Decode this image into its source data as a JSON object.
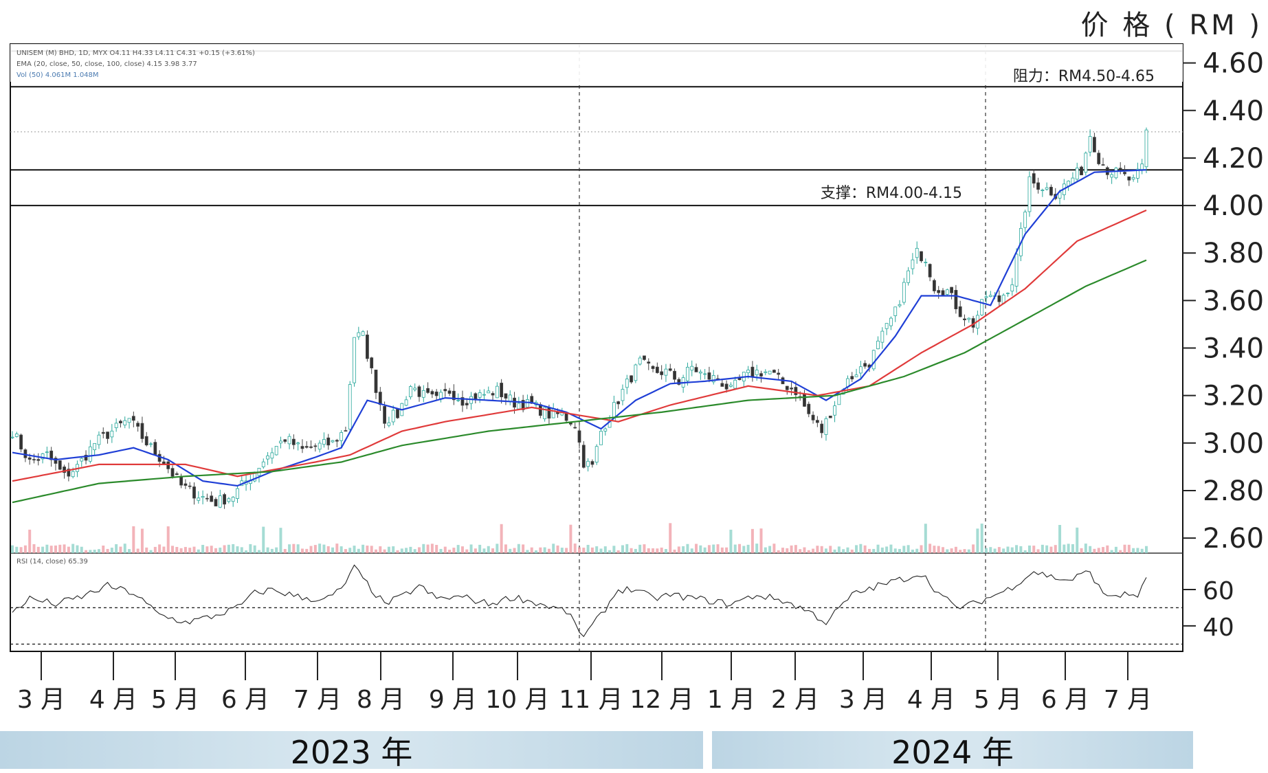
{
  "price_axis_title": "价 格 ( RM )",
  "header": {
    "line1": "UNISEM (M) BHD, 1D, MYX O4.11 H4.33 L4.11 C4.31 +0.15 (+3.61%)",
    "line2": "EMA (20, close, 50, close, 100, close) 4.15 3.98 3.77",
    "line3": "Vol (50) 4.061M 1.048M"
  },
  "annotations": {
    "resistance": "阻力：RM4.50-4.65",
    "support": "支撑：RM4.00-4.15"
  },
  "rsi_label": "RSI (14, close) 65.39",
  "years": [
    "2023 年",
    "2024 年"
  ],
  "chart_data": {
    "type": "candlestick",
    "title": "",
    "price_axis": {
      "ticks": [
        "4.60",
        "4.40",
        "4.20",
        "4.00",
        "3.80",
        "3.60",
        "3.40",
        "3.20",
        "3.00",
        "2.80",
        "2.60"
      ],
      "ylim": [
        2.58,
        4.68
      ]
    },
    "rsi_axis": {
      "ticks": [
        "60",
        "40"
      ],
      "ylim": [
        26,
        80
      ],
      "reference_lines": [
        50,
        30
      ]
    },
    "months": [
      "3 月",
      "4 月",
      "5 月",
      "6 月",
      "7 月",
      "8 月",
      "9 月",
      "10 月",
      "11 月",
      "12 月",
      "1 月",
      "2 月",
      "3 月",
      "4 月",
      "5 月",
      "6 月",
      "7 月"
    ],
    "horizontal_levels": [
      4.65,
      4.5,
      4.15,
      4.0
    ],
    "dotted_level": 4.31,
    "price_anchors": [
      [
        0,
        3.05
      ],
      [
        4,
        2.92
      ],
      [
        8,
        2.95
      ],
      [
        12,
        2.86
      ],
      [
        15,
        2.9
      ],
      [
        19,
        3.0
      ],
      [
        23,
        3.05
      ],
      [
        27,
        3.1
      ],
      [
        31,
        3.0
      ],
      [
        35,
        2.92
      ],
      [
        39,
        2.82
      ],
      [
        43,
        2.78
      ],
      [
        47,
        2.75
      ],
      [
        51,
        2.78
      ],
      [
        55,
        2.86
      ],
      [
        59,
        2.95
      ],
      [
        63,
        3.02
      ],
      [
        67,
        2.97
      ],
      [
        71,
        2.99
      ],
      [
        74,
        3.0
      ],
      [
        77,
        3.06
      ],
      [
        79,
        3.45
      ],
      [
        81,
        3.45
      ],
      [
        83,
        3.3
      ],
      [
        86,
        3.1
      ],
      [
        89,
        3.12
      ],
      [
        92,
        3.24
      ],
      [
        95,
        3.2
      ],
      [
        98,
        3.18
      ],
      [
        101,
        3.22
      ],
      [
        104,
        3.18
      ],
      [
        108,
        3.2
      ],
      [
        112,
        3.22
      ],
      [
        116,
        3.17
      ],
      [
        120,
        3.16
      ],
      [
        124,
        3.12
      ],
      [
        127,
        3.12
      ],
      [
        130,
        3.08
      ],
      [
        132,
        2.92
      ],
      [
        134,
        2.9
      ],
      [
        136,
        3.05
      ],
      [
        139,
        3.15
      ],
      [
        142,
        3.25
      ],
      [
        145,
        3.34
      ],
      [
        148,
        3.3
      ],
      [
        151,
        3.3
      ],
      [
        154,
        3.26
      ],
      [
        157,
        3.32
      ],
      [
        160,
        3.28
      ],
      [
        163,
        3.27
      ],
      [
        166,
        3.22
      ],
      [
        169,
        3.28
      ],
      [
        172,
        3.3
      ],
      [
        175,
        3.3
      ],
      [
        178,
        3.25
      ],
      [
        181,
        3.22
      ],
      [
        184,
        3.12
      ],
      [
        187,
        3.05
      ],
      [
        189,
        3.13
      ],
      [
        192,
        3.24
      ],
      [
        195,
        3.3
      ],
      [
        198,
        3.34
      ],
      [
        201,
        3.45
      ],
      [
        204,
        3.55
      ],
      [
        207,
        3.72
      ],
      [
        209,
        3.8
      ],
      [
        211,
        3.78
      ],
      [
        213,
        3.66
      ],
      [
        216,
        3.64
      ],
      [
        219,
        3.55
      ],
      [
        222,
        3.5
      ],
      [
        225,
        3.62
      ],
      [
        228,
        3.6
      ],
      [
        231,
        3.68
      ],
      [
        233,
        3.88
      ],
      [
        235,
        4.1
      ],
      [
        238,
        4.08
      ],
      [
        241,
        4.05
      ],
      [
        244,
        4.1
      ],
      [
        247,
        4.15
      ],
      [
        249,
        4.3
      ],
      [
        251,
        4.2
      ],
      [
        253,
        4.15
      ],
      [
        256,
        4.13
      ],
      [
        259,
        4.1
      ],
      [
        261,
        4.16
      ],
      [
        262,
        4.31
      ]
    ],
    "ema_anchors": {
      "EMA20": [
        [
          0,
          2.96
        ],
        [
          10,
          2.93
        ],
        [
          20,
          2.95
        ],
        [
          28,
          2.98
        ],
        [
          36,
          2.93
        ],
        [
          44,
          2.84
        ],
        [
          52,
          2.82
        ],
        [
          60,
          2.88
        ],
        [
          70,
          2.94
        ],
        [
          76,
          2.98
        ],
        [
          82,
          3.18
        ],
        [
          90,
          3.14
        ],
        [
          100,
          3.19
        ],
        [
          110,
          3.18
        ],
        [
          120,
          3.17
        ],
        [
          128,
          3.13
        ],
        [
          136,
          3.06
        ],
        [
          144,
          3.18
        ],
        [
          152,
          3.25
        ],
        [
          160,
          3.26
        ],
        [
          170,
          3.28
        ],
        [
          180,
          3.26
        ],
        [
          188,
          3.18
        ],
        [
          196,
          3.27
        ],
        [
          204,
          3.45
        ],
        [
          210,
          3.62
        ],
        [
          218,
          3.62
        ],
        [
          226,
          3.58
        ],
        [
          234,
          3.88
        ],
        [
          242,
          4.06
        ],
        [
          250,
          4.14
        ],
        [
          262,
          4.15
        ]
      ],
      "EMA50": [
        [
          0,
          2.84
        ],
        [
          20,
          2.91
        ],
        [
          40,
          2.91
        ],
        [
          52,
          2.86
        ],
        [
          70,
          2.92
        ],
        [
          78,
          2.95
        ],
        [
          90,
          3.05
        ],
        [
          100,
          3.09
        ],
        [
          120,
          3.15
        ],
        [
          130,
          3.12
        ],
        [
          140,
          3.09
        ],
        [
          152,
          3.16
        ],
        [
          170,
          3.24
        ],
        [
          186,
          3.2
        ],
        [
          198,
          3.24
        ],
        [
          210,
          3.38
        ],
        [
          222,
          3.5
        ],
        [
          234,
          3.65
        ],
        [
          246,
          3.85
        ],
        [
          262,
          3.98
        ]
      ],
      "EMA100": [
        [
          0,
          2.75
        ],
        [
          20,
          2.83
        ],
        [
          40,
          2.86
        ],
        [
          60,
          2.88
        ],
        [
          76,
          2.92
        ],
        [
          90,
          2.99
        ],
        [
          110,
          3.05
        ],
        [
          130,
          3.09
        ],
        [
          150,
          3.13
        ],
        [
          170,
          3.18
        ],
        [
          190,
          3.2
        ],
        [
          206,
          3.28
        ],
        [
          220,
          3.38
        ],
        [
          234,
          3.52
        ],
        [
          248,
          3.66
        ],
        [
          262,
          3.77
        ]
      ]
    },
    "rsi_anchors": [
      [
        0,
        48
      ],
      [
        4,
        55
      ],
      [
        10,
        52
      ],
      [
        16,
        56
      ],
      [
        22,
        62
      ],
      [
        28,
        58
      ],
      [
        34,
        46
      ],
      [
        40,
        42
      ],
      [
        46,
        45
      ],
      [
        52,
        50
      ],
      [
        56,
        58
      ],
      [
        60,
        60
      ],
      [
        66,
        56
      ],
      [
        72,
        54
      ],
      [
        76,
        60
      ],
      [
        79,
        72
      ],
      [
        83,
        60
      ],
      [
        86,
        52
      ],
      [
        90,
        56
      ],
      [
        94,
        62
      ],
      [
        98,
        55
      ],
      [
        104,
        56
      ],
      [
        110,
        52
      ],
      [
        116,
        56
      ],
      [
        122,
        52
      ],
      [
        128,
        48
      ],
      [
        132,
        34
      ],
      [
        136,
        46
      ],
      [
        140,
        60
      ],
      [
        144,
        60
      ],
      [
        148,
        55
      ],
      [
        152,
        57
      ],
      [
        158,
        55
      ],
      [
        166,
        52
      ],
      [
        172,
        57
      ],
      [
        178,
        54
      ],
      [
        184,
        48
      ],
      [
        188,
        42
      ],
      [
        194,
        57
      ],
      [
        200,
        62
      ],
      [
        206,
        66
      ],
      [
        210,
        69
      ],
      [
        214,
        58
      ],
      [
        218,
        50
      ],
      [
        222,
        52
      ],
      [
        226,
        56
      ],
      [
        230,
        60
      ],
      [
        236,
        70
      ],
      [
        240,
        67
      ],
      [
        244,
        65
      ],
      [
        249,
        70
      ],
      [
        252,
        57
      ],
      [
        256,
        57
      ],
      [
        260,
        57
      ],
      [
        262,
        65
      ]
    ],
    "ema_colors": {
      "EMA20": "#1f3fd6",
      "EMA50": "#e03a3a",
      "EMA100": "#2b8a2b"
    }
  }
}
